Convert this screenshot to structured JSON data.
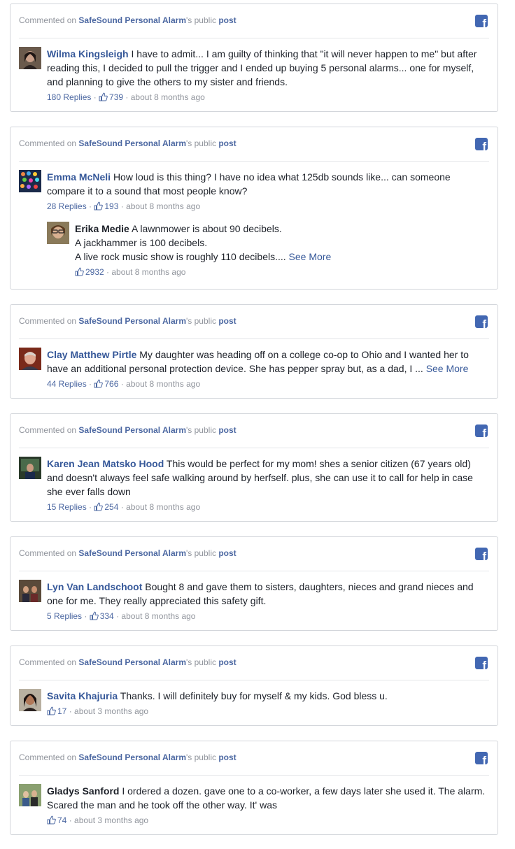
{
  "labels": {
    "commented_on": "Commented on ",
    "page_name": "SafeSound Personal Alarm",
    "possessive": "'s public ",
    "post": "post",
    "dot": " · "
  },
  "comments": [
    {
      "author": "Wilma Kingsleigh",
      "text": "I have to admit... I am guilty of thinking that \"it will never happen to me\" but after reading this, I decided to pull the trigger and I ended up buying 5 personal alarms... one for myself, and planning to give the others to my sister and friends.",
      "replies": "180 Replies",
      "likes": "739",
      "time": "about 8 months ago"
    },
    {
      "author": "Emma McNeli",
      "text": "How loud is this thing? I have no idea what 125db sounds like... can someone compare it to a sound that most people know?",
      "replies": "28 Replies",
      "likes": "193",
      "time": "about 8 months ago",
      "reply": {
        "author": "Erika Medie",
        "line1": "A lawnmower is about 90 decibels.",
        "line2": "A jackhammer is 100 decibels.",
        "line3": "A live rock music show is roughly 110 decibels....",
        "see_more": "See More",
        "likes": "2932",
        "time": "about 8 months ago"
      }
    },
    {
      "author": "Clay Matthew Pirtle",
      "text": "My daughter was heading off on a college co-op to Ohio and I wanted her to have an additional personal protection device. She has pepper spray but, as a dad, I ...",
      "see_more": "See More",
      "replies": "44 Replies",
      "likes": "766",
      "time": "about 8 months ago"
    },
    {
      "author": "Karen Jean Matsko Hood",
      "text": "This would be perfect for my mom! shes a senior citizen (67 years old) and doesn't always feel safe walking around by herfself. plus, she can use it to call for help in case she ever falls down",
      "replies": "15 Replies",
      "likes": "254",
      "time": "about 8 months ago"
    },
    {
      "author": "Lyn Van Landschoot",
      "text": "Bought 8 and gave them to sisters, daughters, nieces and grand nieces and one for me. They really appreciated this safety gift.",
      "replies": "5 Replies",
      "likes": "334",
      "time": "about 8 months ago"
    },
    {
      "author": "Savita Khajuria",
      "text": "Thanks. I will definitely buy for myself & my kids. God bless u.",
      "likes": "17",
      "time": "about 3 months ago"
    },
    {
      "author": "Gladys Sanford",
      "text": "I ordered a dozen. gave one to a co-worker, a few days later she used it. The alarm. Scared the man and he took off the other way. It' was",
      "likes": "74",
      "time": "about 3 months ago"
    }
  ],
  "icons": {
    "facebook": "facebook-icon",
    "like": "thumbs-up-icon"
  },
  "colors": {
    "link": "#365899",
    "meta": "#90949c",
    "facebook_blue": "#4267b2",
    "border": "#d3d6db"
  }
}
